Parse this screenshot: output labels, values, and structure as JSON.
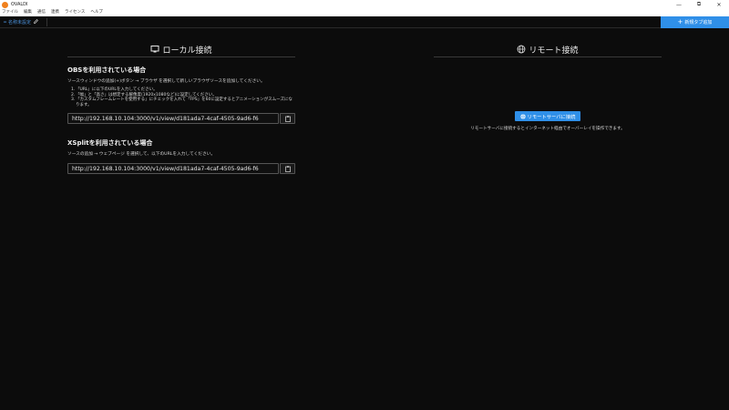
{
  "window": {
    "title": "OVALDI",
    "controls": {
      "minimize": "—",
      "maximize": "⧉",
      "close": "✕"
    }
  },
  "menu": {
    "items": [
      "ファイル",
      "編集",
      "通信",
      "連携",
      "ライセンス",
      "ヘルプ"
    ]
  },
  "tabs": {
    "active_label": "名称未設定",
    "new_tab_label": "新規タブ追加"
  },
  "local": {
    "title": "ローカル接続",
    "obs": {
      "heading": "OBSを利用されている場合",
      "description": "ソースウィンドウの追加(+)ボタン → ブラウザ を選択して新しいブラウザソースを追加してください。",
      "steps": [
        "「URL」に以下のURLを入力してください。",
        "「幅」と「高さ」は想定する解像度(1920x1080など)に設定してください。",
        "「カスタムフレームレートを使用する」にチェックを入れて「FPS」を60に設定するとアニメーションがスムーズになります。"
      ],
      "url": "http://192.168.10.104:3000/v1/view/d181ada7-4caf-4505-9ad6-f6"
    },
    "xsplit": {
      "heading": "XSplitを利用されている場合",
      "description": "ソースの追加 → ウェブページ を選択して、以下のURLを入力してください。",
      "url": "http://192.168.10.104:3000/v1/view/d181ada7-4caf-4505-9ad6-f6"
    }
  },
  "remote": {
    "title": "リモート接続",
    "connect_label": "リモートサーバに接続",
    "description": "リモートサーバに接続するとインターネット経由でオーバーレイを操作できます。"
  },
  "colors": {
    "background": "#0c0c0c",
    "accent": "#2f8fe8",
    "app_icon": "#f0801e"
  }
}
